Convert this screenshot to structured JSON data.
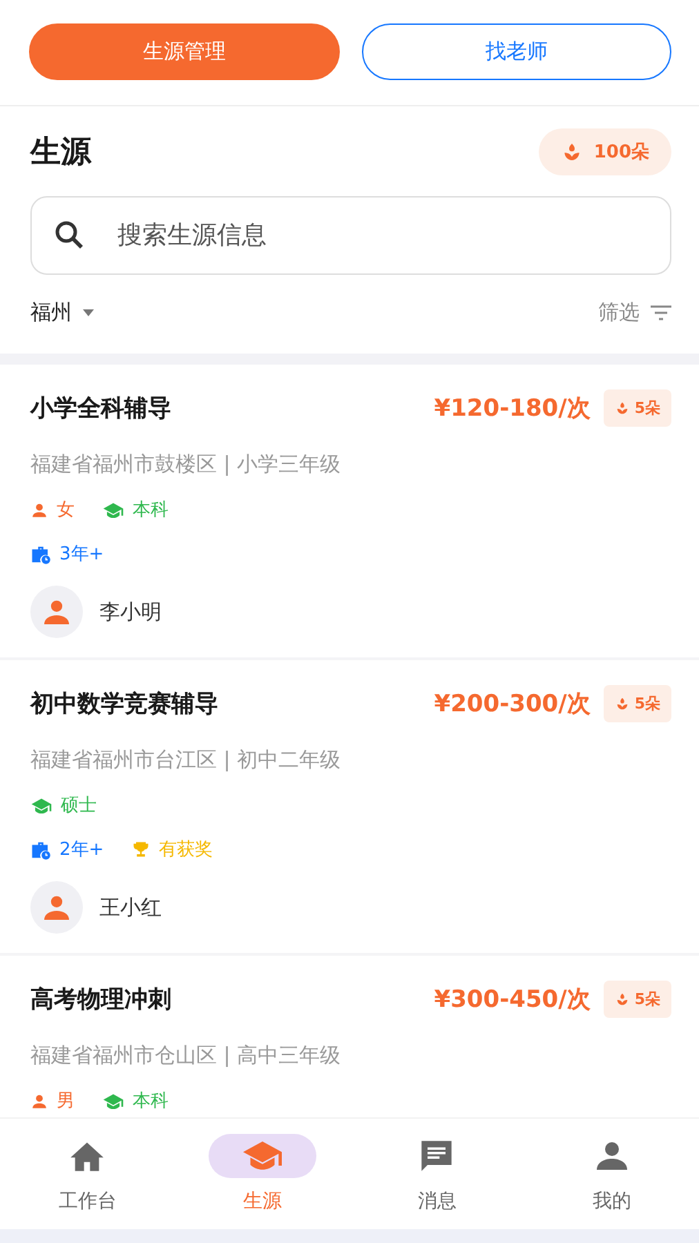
{
  "top_tabs": [
    {
      "label": "生源管理",
      "selected": true
    },
    {
      "label": "找老师",
      "selected": false
    }
  ],
  "header": {
    "title": "生源",
    "flowers": "100朵"
  },
  "search": {
    "placeholder": "搜索生源信息"
  },
  "filter_bar": {
    "city": "福州",
    "filter": "筛选"
  },
  "students": [
    {
      "title": "小学全科辅导",
      "price": "¥120-180/次",
      "cost": "5朵",
      "location": "福建省福州市鼓楼区 | 小学三年级",
      "tag_rows": [
        [
          {
            "kind": "gender",
            "text": "女"
          },
          {
            "kind": "education",
            "text": "本科"
          }
        ],
        [
          {
            "kind": "experience",
            "text": "3年+"
          }
        ]
      ],
      "name": "李小明"
    },
    {
      "title": "初中数学竞赛辅导",
      "price": "¥200-300/次",
      "cost": "5朵",
      "location": "福建省福州市台江区 | 初中二年级",
      "tag_rows": [
        [
          {
            "kind": "education",
            "text": "硕士"
          }
        ],
        [
          {
            "kind": "experience",
            "text": "2年+"
          },
          {
            "kind": "award",
            "text": "有获奖"
          }
        ]
      ],
      "name": "王小红"
    },
    {
      "title": "高考物理冲刺",
      "price": "¥300-450/次",
      "cost": "5朵",
      "location": "福建省福州市仓山区 | 高中三年级",
      "tag_rows": [
        [
          {
            "kind": "gender",
            "text": "男"
          },
          {
            "kind": "education",
            "text": "本科"
          }
        ]
      ]
    }
  ],
  "nav": [
    {
      "label": "工作台",
      "kind": "home",
      "selected": false
    },
    {
      "label": "生源",
      "kind": "cap",
      "selected": true
    },
    {
      "label": "消息",
      "kind": "chat",
      "selected": false
    },
    {
      "label": "我的",
      "kind": "person",
      "selected": false
    }
  ]
}
